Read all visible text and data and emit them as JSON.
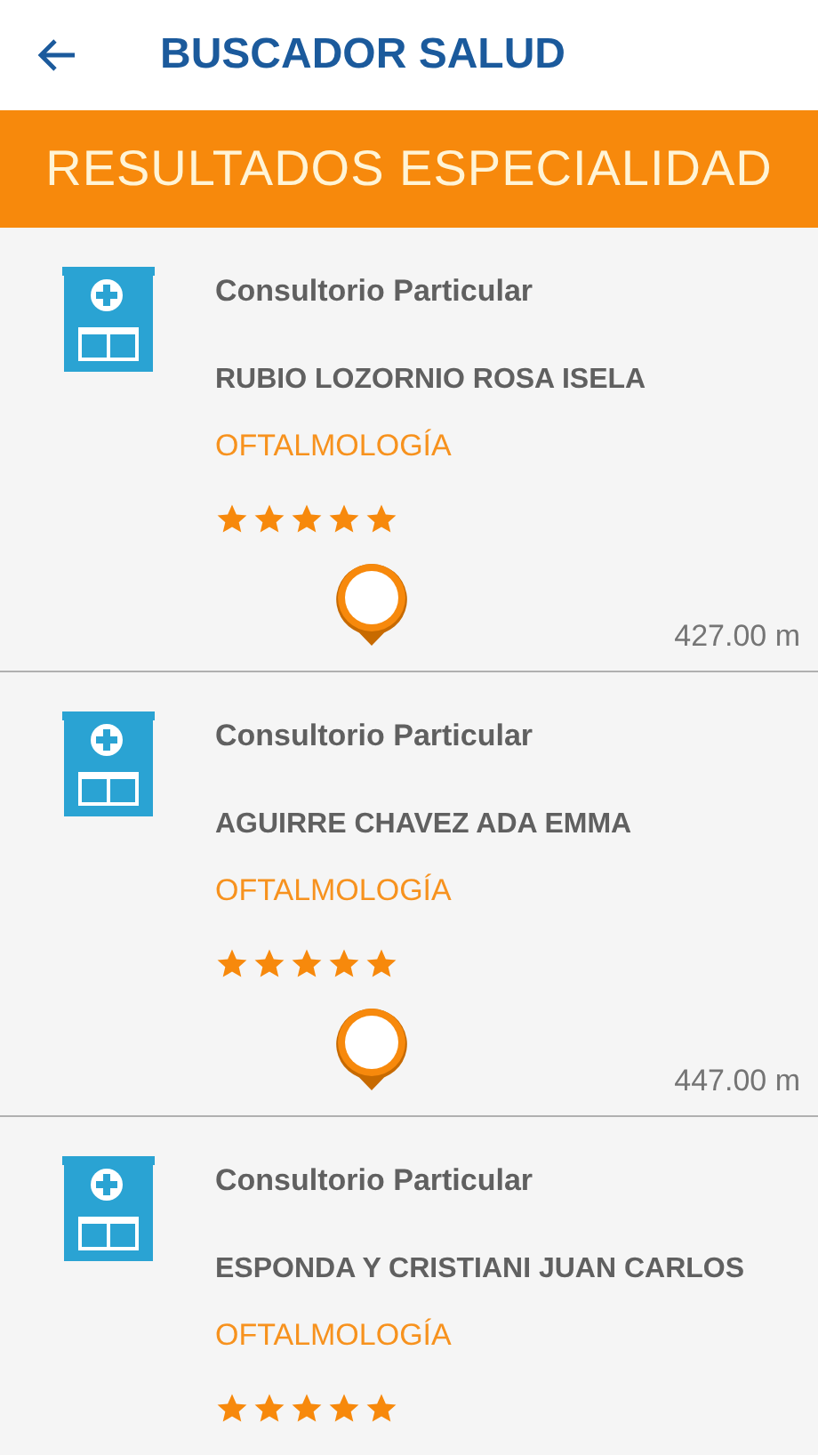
{
  "header": {
    "title": "BUSCADOR SALUD"
  },
  "banner": {
    "title": "RESULTADOS ESPECIALIDAD"
  },
  "results": [
    {
      "category": "Consultorio Particular",
      "name": "RUBIO LOZORNIO ROSA ISELA",
      "specialty": "OFTALMOLOGÍA",
      "stars": 5,
      "distance": "427.00 m"
    },
    {
      "category": "Consultorio Particular",
      "name": "AGUIRRE CHAVEZ ADA EMMA",
      "specialty": "OFTALMOLOGÍA",
      "stars": 5,
      "distance": "447.00 m"
    },
    {
      "category": "Consultorio Particular",
      "name": "ESPONDA Y CRISTIANI JUAN CARLOS",
      "specialty": "OFTALMOLOGÍA",
      "stars": 5
    }
  ]
}
